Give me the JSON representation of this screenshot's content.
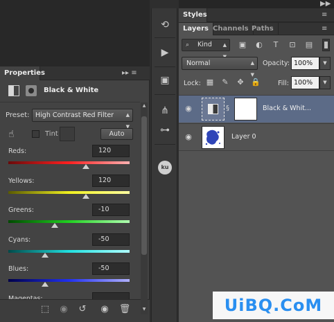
{
  "window_controls": {
    "collapse_left": "◀◀",
    "collapse_right": "▶▶",
    "close": "✕"
  },
  "properties": {
    "tab_label": "Properties",
    "tab_menu": "▸▸ ≡",
    "adjustment_title": "Black & White",
    "preset_label": "Preset:",
    "preset_value": "High Contrast Red Filter",
    "tint_label": "Tint",
    "tint_checked": false,
    "auto_label": "Auto",
    "sliders": [
      {
        "label": "Reds:",
        "value": "120",
        "thumb_fraction": 0.64,
        "gradient": [
          "#6a0a0a",
          "#ff2020",
          "#ffb0b0"
        ]
      },
      {
        "label": "Yellows:",
        "value": "120",
        "thumb_fraction": 0.64,
        "gradient": [
          "#5a5a00",
          "#f0f020",
          "#ffffa0"
        ]
      },
      {
        "label": "Greens:",
        "value": "-10",
        "thumb_fraction": 0.38,
        "gradient": [
          "#004a00",
          "#20d020",
          "#b0ffb0"
        ]
      },
      {
        "label": "Cyans:",
        "value": "-50",
        "thumb_fraction": 0.3,
        "gradient": [
          "#004a4a",
          "#20e0e0",
          "#b0ffff"
        ]
      },
      {
        "label": "Blues:",
        "value": "-50",
        "thumb_fraction": 0.3,
        "gradient": [
          "#00004a",
          "#2030f0",
          "#b0b0ff"
        ]
      },
      {
        "label": "Magentas:",
        "value": "",
        "thumb_fraction": 0.5,
        "gradient": [
          "#4a004a",
          "#e020e0",
          "#ffb0ff"
        ]
      }
    ],
    "footer_icons": [
      "clip-to-layer-icon",
      "view-previous-icon",
      "reset-icon",
      "visibility-icon",
      "trash-icon"
    ]
  },
  "toolbar": {
    "tools": [
      "history-brush-icon",
      "play-icon",
      "adjustments-icon",
      "brush-presets-icon",
      "tool-presets-icon"
    ],
    "ku_label": "ku"
  },
  "styles": {
    "tab_label": "Styles"
  },
  "layers": {
    "tabs": [
      "Layers",
      "Channels",
      "Paths"
    ],
    "kind_label": "Kind",
    "blend_mode": "Normal",
    "opacity_label": "Opacity:",
    "opacity_value": "100%",
    "lock_label": "Lock:",
    "fill_label": "Fill:",
    "fill_value": "100%",
    "items": [
      {
        "name": "Black & Whit...",
        "selected": true
      },
      {
        "name": "Layer 0",
        "selected": false
      }
    ]
  },
  "watermark": "UiBQ.CoM",
  "colors": {
    "panel": "#434343",
    "layers_bg": "#535353",
    "selected_layer": "#5c6b87",
    "watermark_text": "#2a8ff0"
  }
}
